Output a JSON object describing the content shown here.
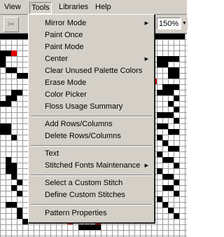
{
  "menubar": {
    "view": "View",
    "tools": "Tools",
    "libraries": "Libraries",
    "help": "Help"
  },
  "toolbar": {
    "scissors_icon": "✂",
    "zoom_value": "150%"
  },
  "tools_menu": {
    "items": [
      {
        "label": "Mirror Mode",
        "submenu": true
      },
      {
        "label": "Paint Once",
        "submenu": false
      },
      {
        "label": "Paint Mode",
        "submenu": false
      },
      {
        "label": "Center",
        "submenu": true
      },
      {
        "label": "Clear Unused Palette Colors",
        "submenu": false
      },
      {
        "label": "Erase Mode",
        "submenu": false
      },
      {
        "label": "Color Picker",
        "submenu": false
      },
      {
        "label": "Floss Usage Summary",
        "submenu": false
      },
      {
        "label": "Add Rows/Columns",
        "submenu": false
      },
      {
        "label": "Delete Rows/Columns",
        "submenu": false
      },
      {
        "label": "Text",
        "submenu": false
      },
      {
        "label": "Stitched Fonts Maintenance",
        "submenu": true
      },
      {
        "label": "Select a Custom Stitch",
        "submenu": false
      },
      {
        "label": "Define Custom Stitches",
        "submenu": false
      },
      {
        "label": "Pattern Properties",
        "submenu": false
      }
    ],
    "arrow_glyph": "▶"
  },
  "colors": {
    "stitch_black": "#000000",
    "stitch_red": "#e00000",
    "chrome": "#d4d0c8"
  }
}
